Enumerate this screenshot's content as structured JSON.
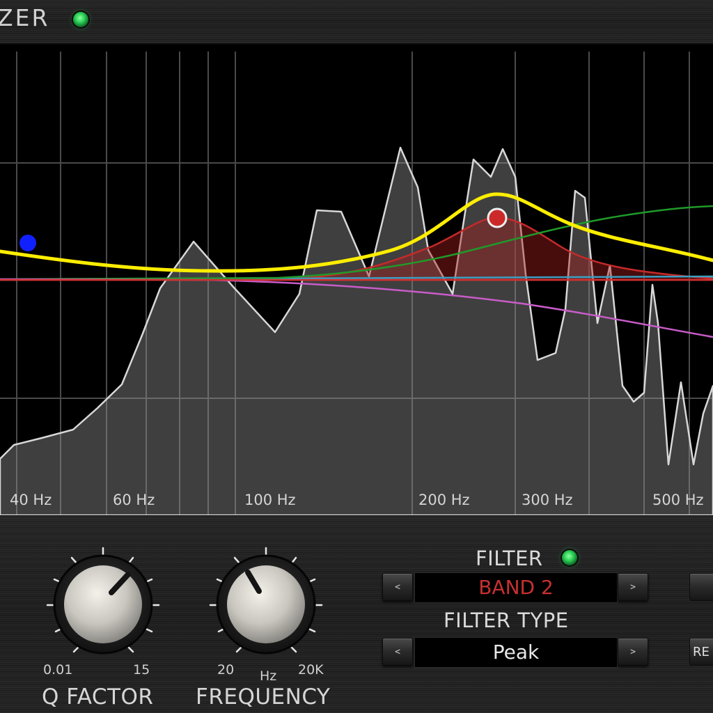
{
  "header": {
    "title": "ZER",
    "power_led_color": "#2fd45a"
  },
  "graph": {
    "freq_axis_labels": [
      "40 Hz",
      "60 Hz",
      "100 Hz",
      "200 Hz",
      "300 Hz",
      "500 Hz"
    ],
    "curve_colors": {
      "total_response": "#ffee00",
      "band_2": "#cc2a2a",
      "band_high_shelf": "#1f9a2a",
      "band_low_pass": "#c85cc8",
      "band_flat": "#3a9fc2",
      "spectrum": "#cfcfcf",
      "band_1_handle": "#1020ff"
    }
  },
  "controls": {
    "q_factor": {
      "label": "Q FACTOR",
      "min": "0.01",
      "max": "15"
    },
    "frequency": {
      "label": "FREQUENCY",
      "min": "20",
      "max": "20K",
      "unit": "Hz"
    },
    "filter": {
      "label": "FILTER",
      "prev_glyph": "<",
      "next_glyph": ">",
      "value": "BAND 2",
      "value_color": "#c83030"
    },
    "filter_type": {
      "label": "FILTER TYPE",
      "prev_glyph": "<",
      "next_glyph": ">",
      "value": "Peak",
      "value_color": "#e8e8e8"
    },
    "side_button_label": "RE"
  }
}
